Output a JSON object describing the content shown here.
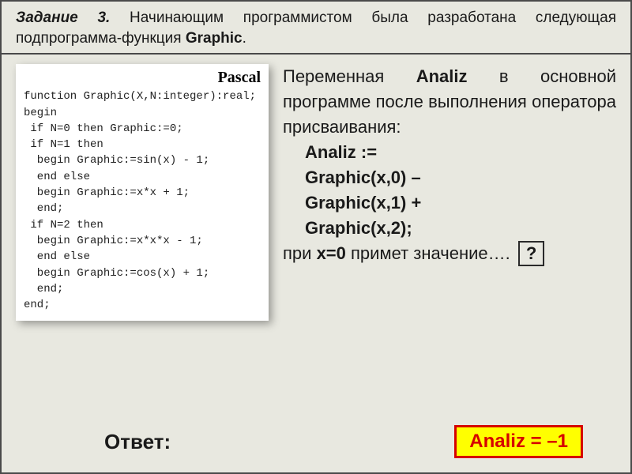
{
  "task": {
    "lead": "Задание 3.",
    "text_before_fn": " Начинающим программистом была разработана следующая подпрограмма-функция ",
    "fn_name": "Graphic",
    "tail": "."
  },
  "code": {
    "title": "Pascal",
    "source": "function Graphic(X,N:integer):real;\nbegin\n if N=0 then Graphic:=0;\n if N=1 then\n  begin Graphic:=sin(x) - 1;\n  end else\n  begin Graphic:=x*x + 1;\n  end;\n if N=2 then\n  begin Graphic:=x*x*x - 1;\n  end else\n  begin Graphic:=cos(x) + 1;\n  end;\nend;"
  },
  "explain": {
    "p1_prefix": "Переменная ",
    "p1_bold": "Analiz",
    "p1_suffix": " в основной программе после выполнения оператора присваивания:",
    "expr_line1": "Analiz :=",
    "expr_line2": "Graphic(x,0) –",
    "expr_line3": "Graphic(x,1) +",
    "expr_line4": "Graphic(x,2);",
    "p2_prefix": "при ",
    "p2_bold": "x=0",
    "p2_suffix": " примет значение….",
    "qmark": "?"
  },
  "answer": {
    "label": "Ответ:",
    "value": "Analiz = –1"
  }
}
